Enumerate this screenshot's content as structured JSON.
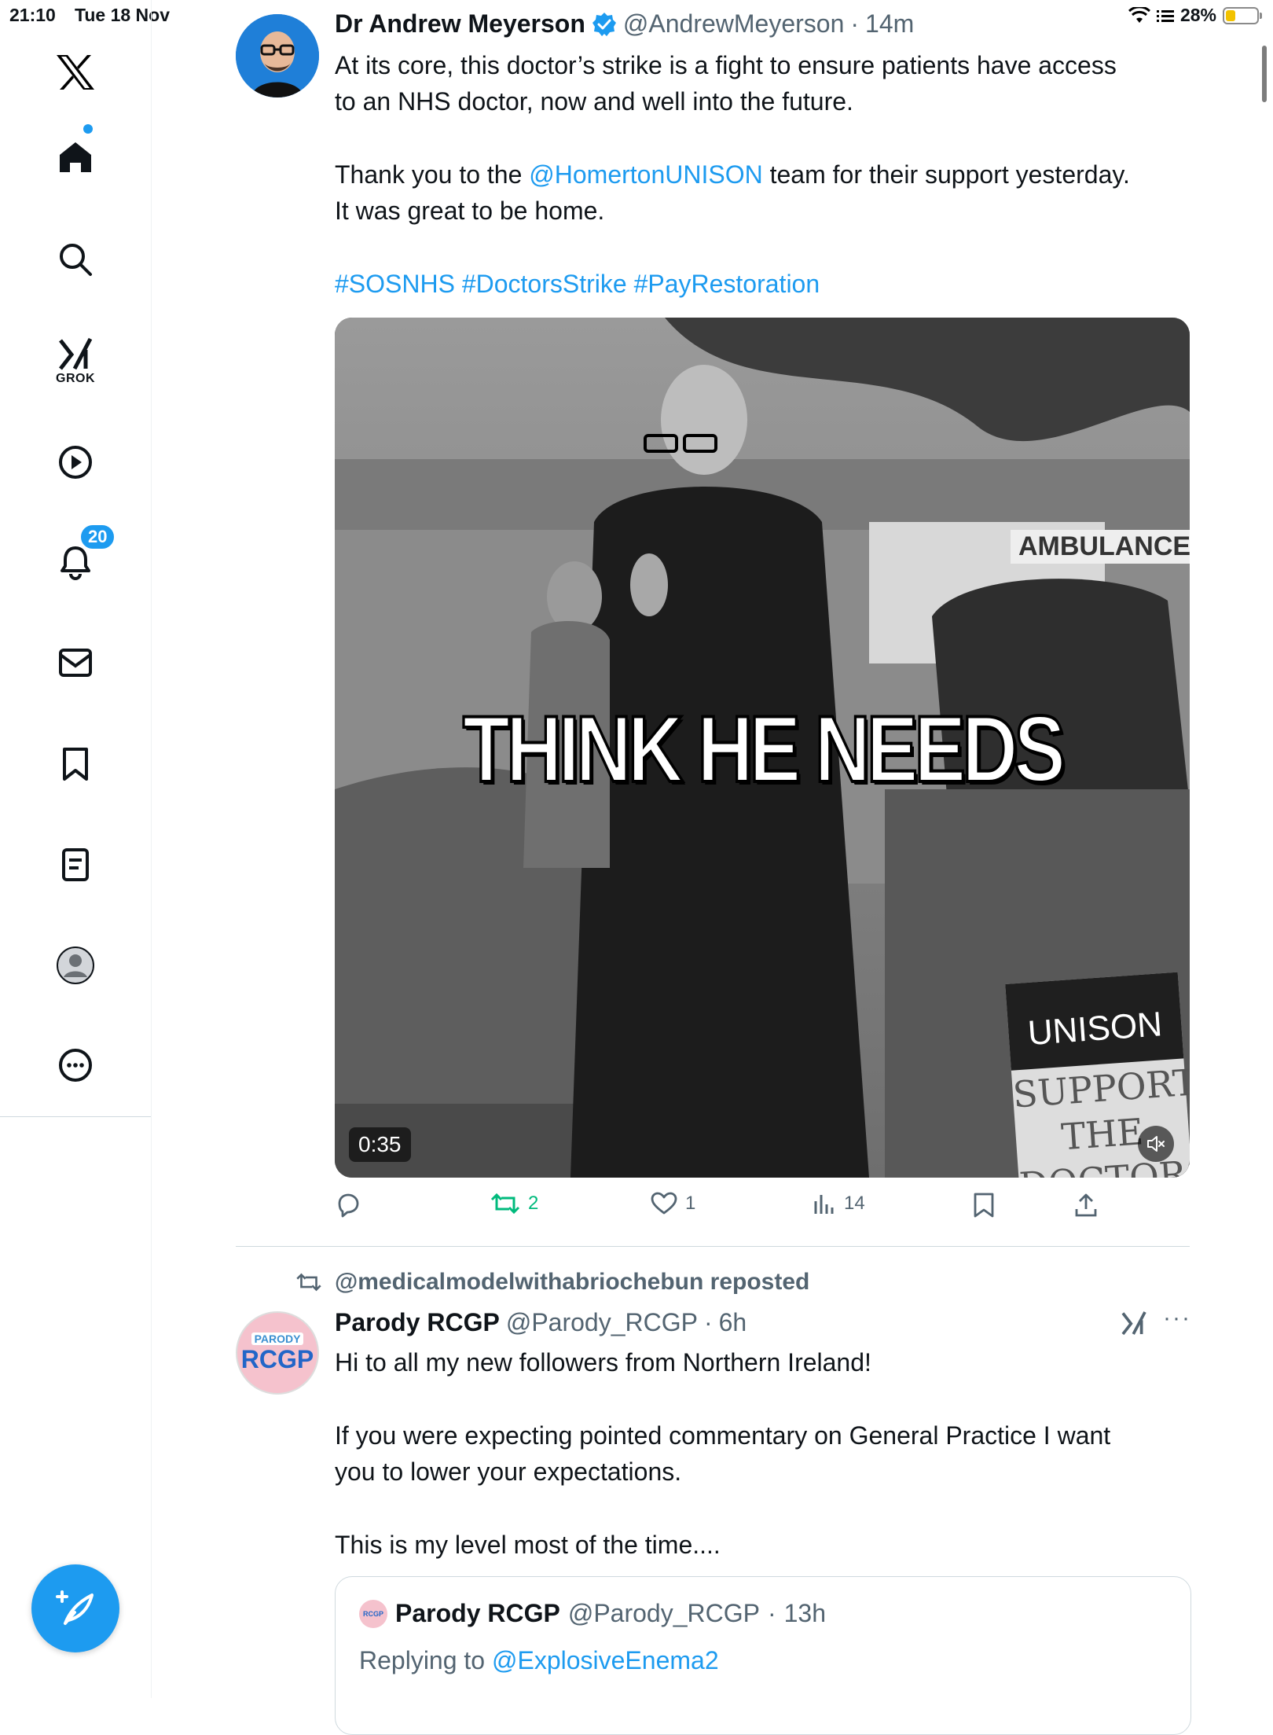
{
  "status_bar": {
    "time": "21:10",
    "date": "Tue 18 Nov",
    "battery": "28%",
    "battery_level": 0.28
  },
  "sidebar": {
    "items": [
      {
        "name": "x-logo"
      },
      {
        "name": "home"
      },
      {
        "name": "search"
      },
      {
        "name": "grok",
        "label": "GROK"
      },
      {
        "name": "video"
      },
      {
        "name": "notifications",
        "badge": "20"
      },
      {
        "name": "messages"
      },
      {
        "name": "bookmarks"
      },
      {
        "name": "lists"
      },
      {
        "name": "profile"
      },
      {
        "name": "more"
      }
    ],
    "compose_icon": "feather-plus-icon"
  },
  "tweet1": {
    "name": "Dr Andrew Meyerson",
    "verified": true,
    "handle": "@AndrewMeyerson",
    "sep": "·",
    "time": "14m",
    "line1": "At its core, this doctor’s strike is a fight to ensure patients have access",
    "line2": "to an NHS doctor, now and well into the future.",
    "line3_pre": "Thank you to the ",
    "line3_mention": "@HomertonUNISON",
    "line3_post": " team for their support yesterday.",
    "line4": "It was great to be home.",
    "hashtags": "#SOSNHS #DoctorsStrike #PayRestoration",
    "video": {
      "caption": "THINK HE NEEDS",
      "duration": "0:35",
      "sign_top": "UNISON",
      "sign_text": "SUPPORT THE DOCTORS",
      "ambulance_text": "AMBULANCE"
    },
    "actions": {
      "replies": "",
      "reposts": "2",
      "likes": "1",
      "views": "14"
    }
  },
  "tweet2": {
    "reposted_by": "@medicalmodelwithabriochebun reposted",
    "name": "Parody RCGP",
    "handle": "@Parody_RCGP",
    "sep": "·",
    "time": "6h",
    "avatar_small": "PARODY",
    "avatar_big": "RCGP",
    "more": "···",
    "line1": "Hi to all my new followers from Northern Ireland!",
    "line2": "If you were expecting pointed commentary on General Practice I want",
    "line3": "you to lower your expectations.",
    "line4": "This is my level most of the time....",
    "quote": {
      "avatar": "RCGP",
      "name": "Parody RCGP",
      "handle": "@Parody_RCGP",
      "sep": "·",
      "time": "13h",
      "reply_pre": "Replying to ",
      "reply_mention": "@ExplosiveEnema2"
    }
  },
  "colors": {
    "accent": "#1d9bf0",
    "text": "#0f1419",
    "muted": "#536471",
    "repost_green": "#00ba7c"
  }
}
